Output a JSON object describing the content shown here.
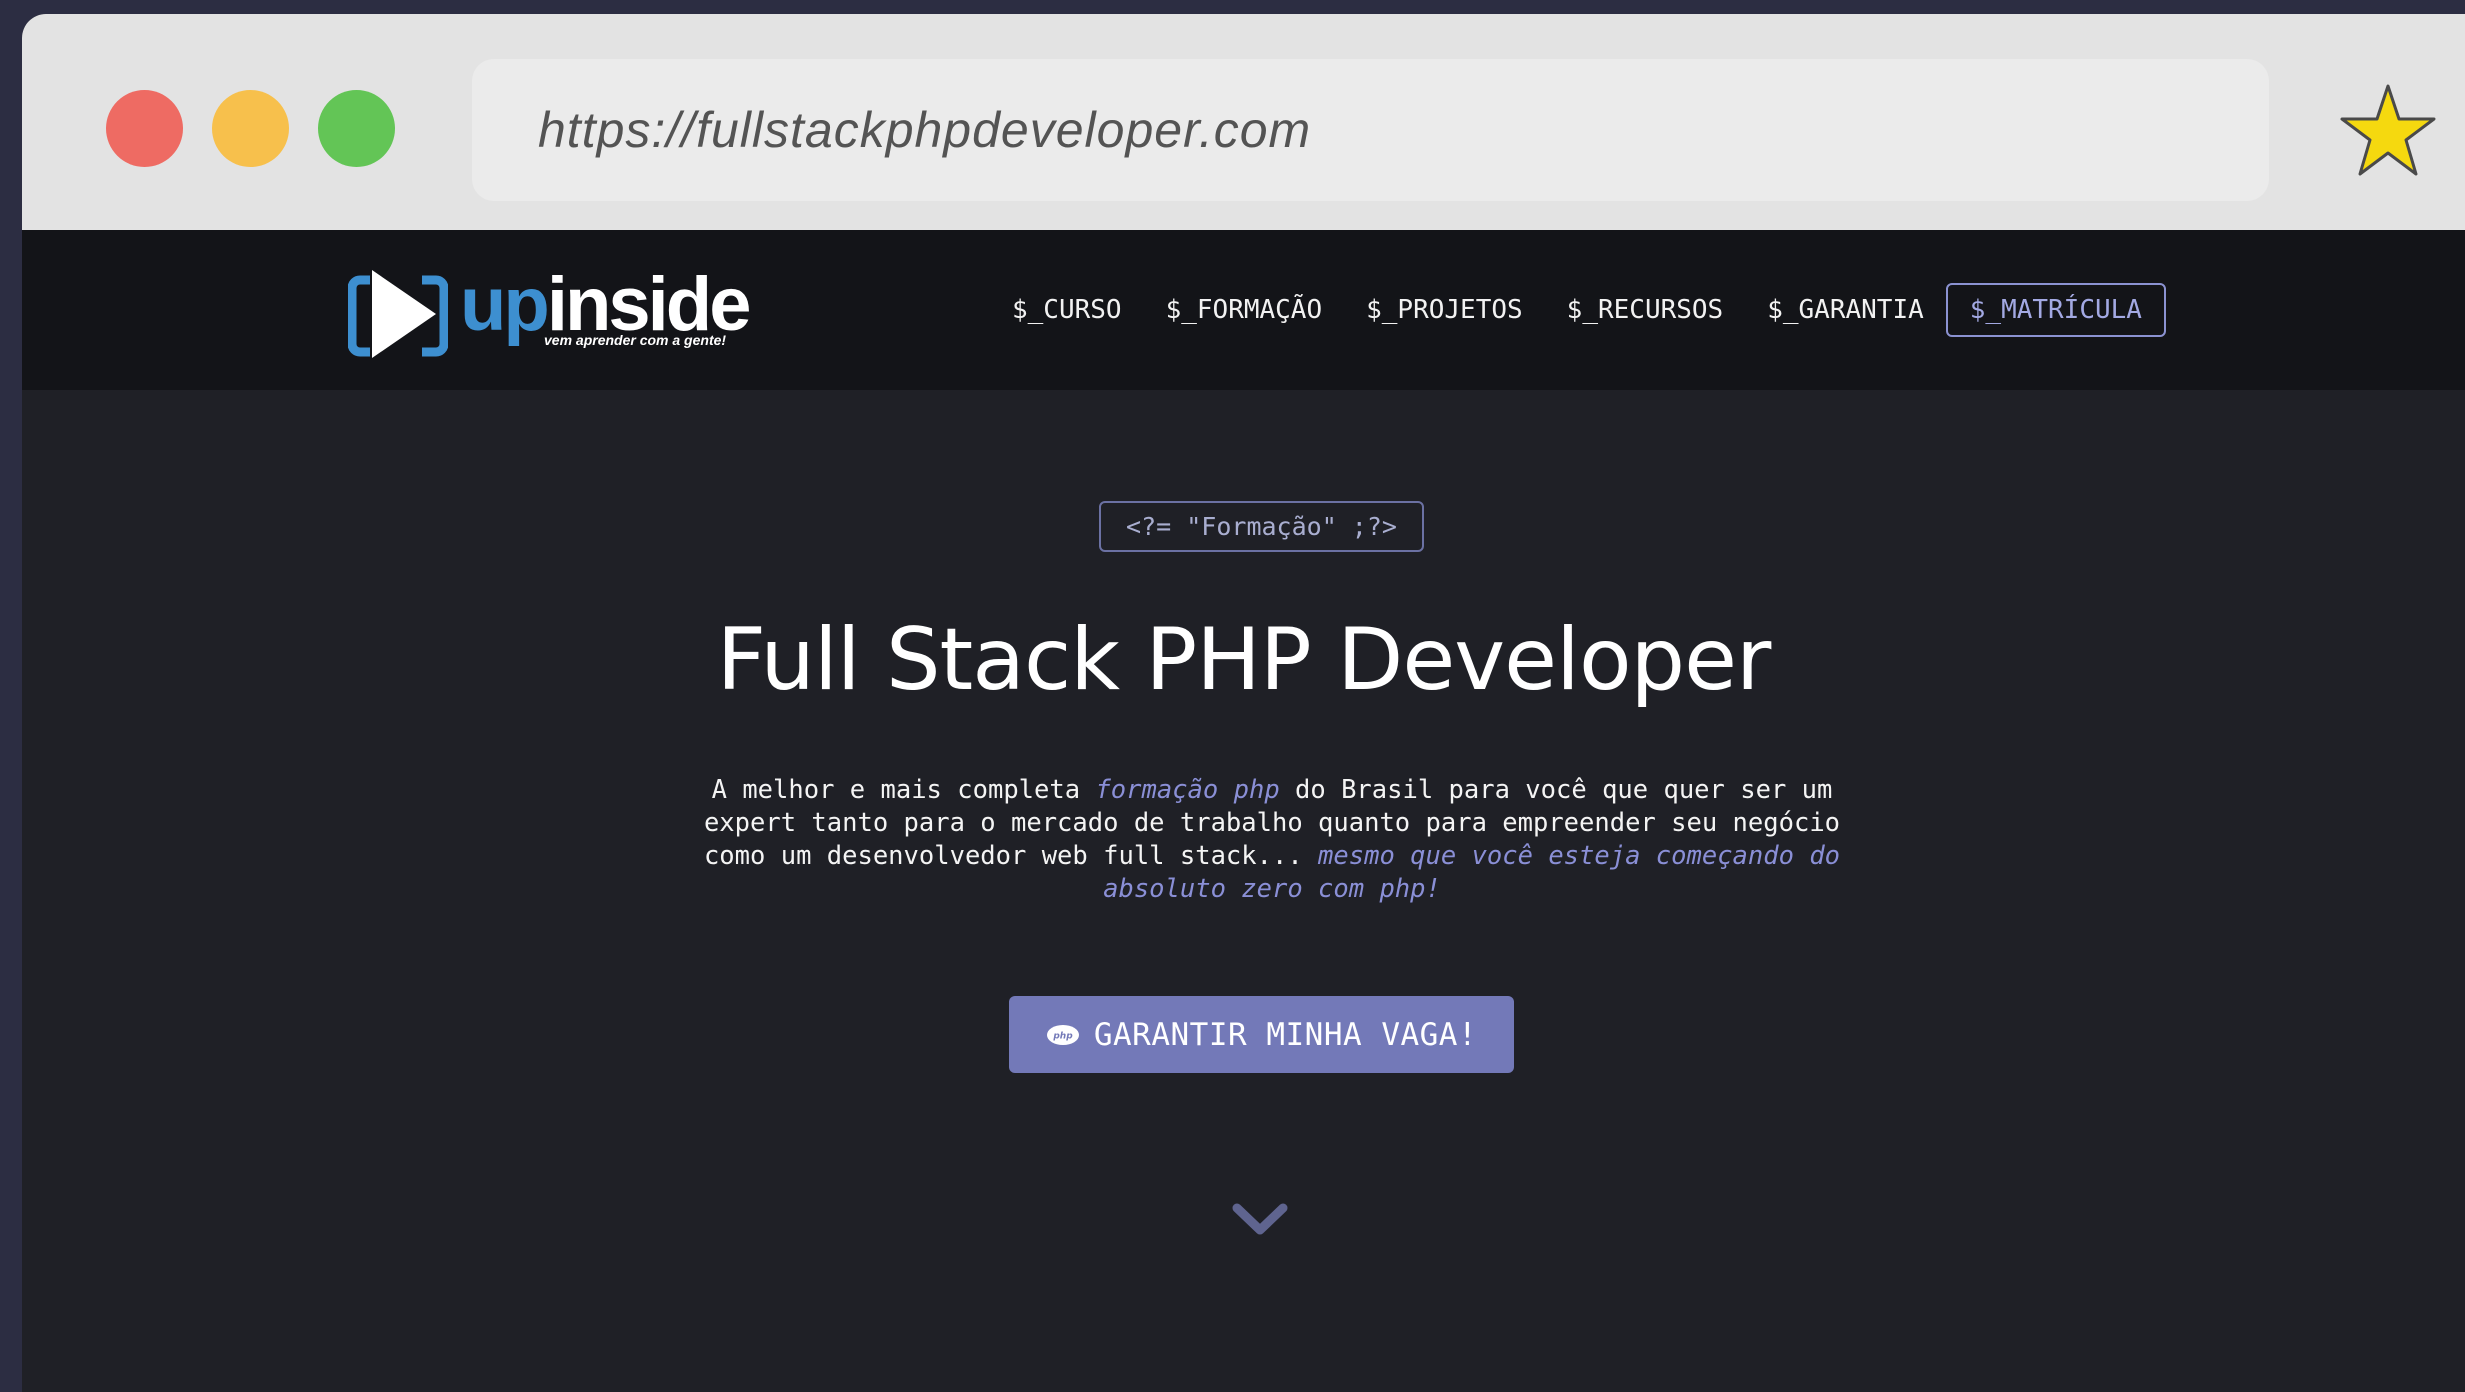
{
  "browser": {
    "url": "https://fullstackphpdeveloper.com",
    "traffic_lights": {
      "close_color": "#ee6b63",
      "minimize_color": "#f7c04c",
      "maximize_color": "#63c556"
    },
    "bookmark_icon": "star-icon",
    "bookmark_color": "#f5d90f"
  },
  "header": {
    "logo": {
      "word_part1": "up",
      "word_part2": "inside",
      "tagline": "vem aprender com a gente!",
      "brand_color": "#3d8fd0"
    },
    "nav": [
      {
        "label": "$_CURSO"
      },
      {
        "label": "$_FORMAÇÃO"
      },
      {
        "label": "$_PROJETOS"
      },
      {
        "label": "$_RECURSOS"
      },
      {
        "label": "$_GARANTIA"
      }
    ],
    "cta_label": "$_MATRÍCULA"
  },
  "hero": {
    "badge": "<?= \"Formação\" ;?>",
    "title": "Full Stack PHP Developer",
    "description": {
      "part1": "A melhor e mais completa ",
      "highlight1": "formação php",
      "part2": " do Brasil para você que quer ser um expert tanto para o mercado de trabalho quanto para empreender seu negócio como um desenvolvedor web full stack... ",
      "highlight2": "mesmo que você esteja começando do absoluto zero com php!"
    },
    "button_icon": "php-icon",
    "button_label": "GARANTIR MINHA VAGA!",
    "scroll_icon": "chevron-down-icon",
    "accent_color": "#7379b8"
  }
}
